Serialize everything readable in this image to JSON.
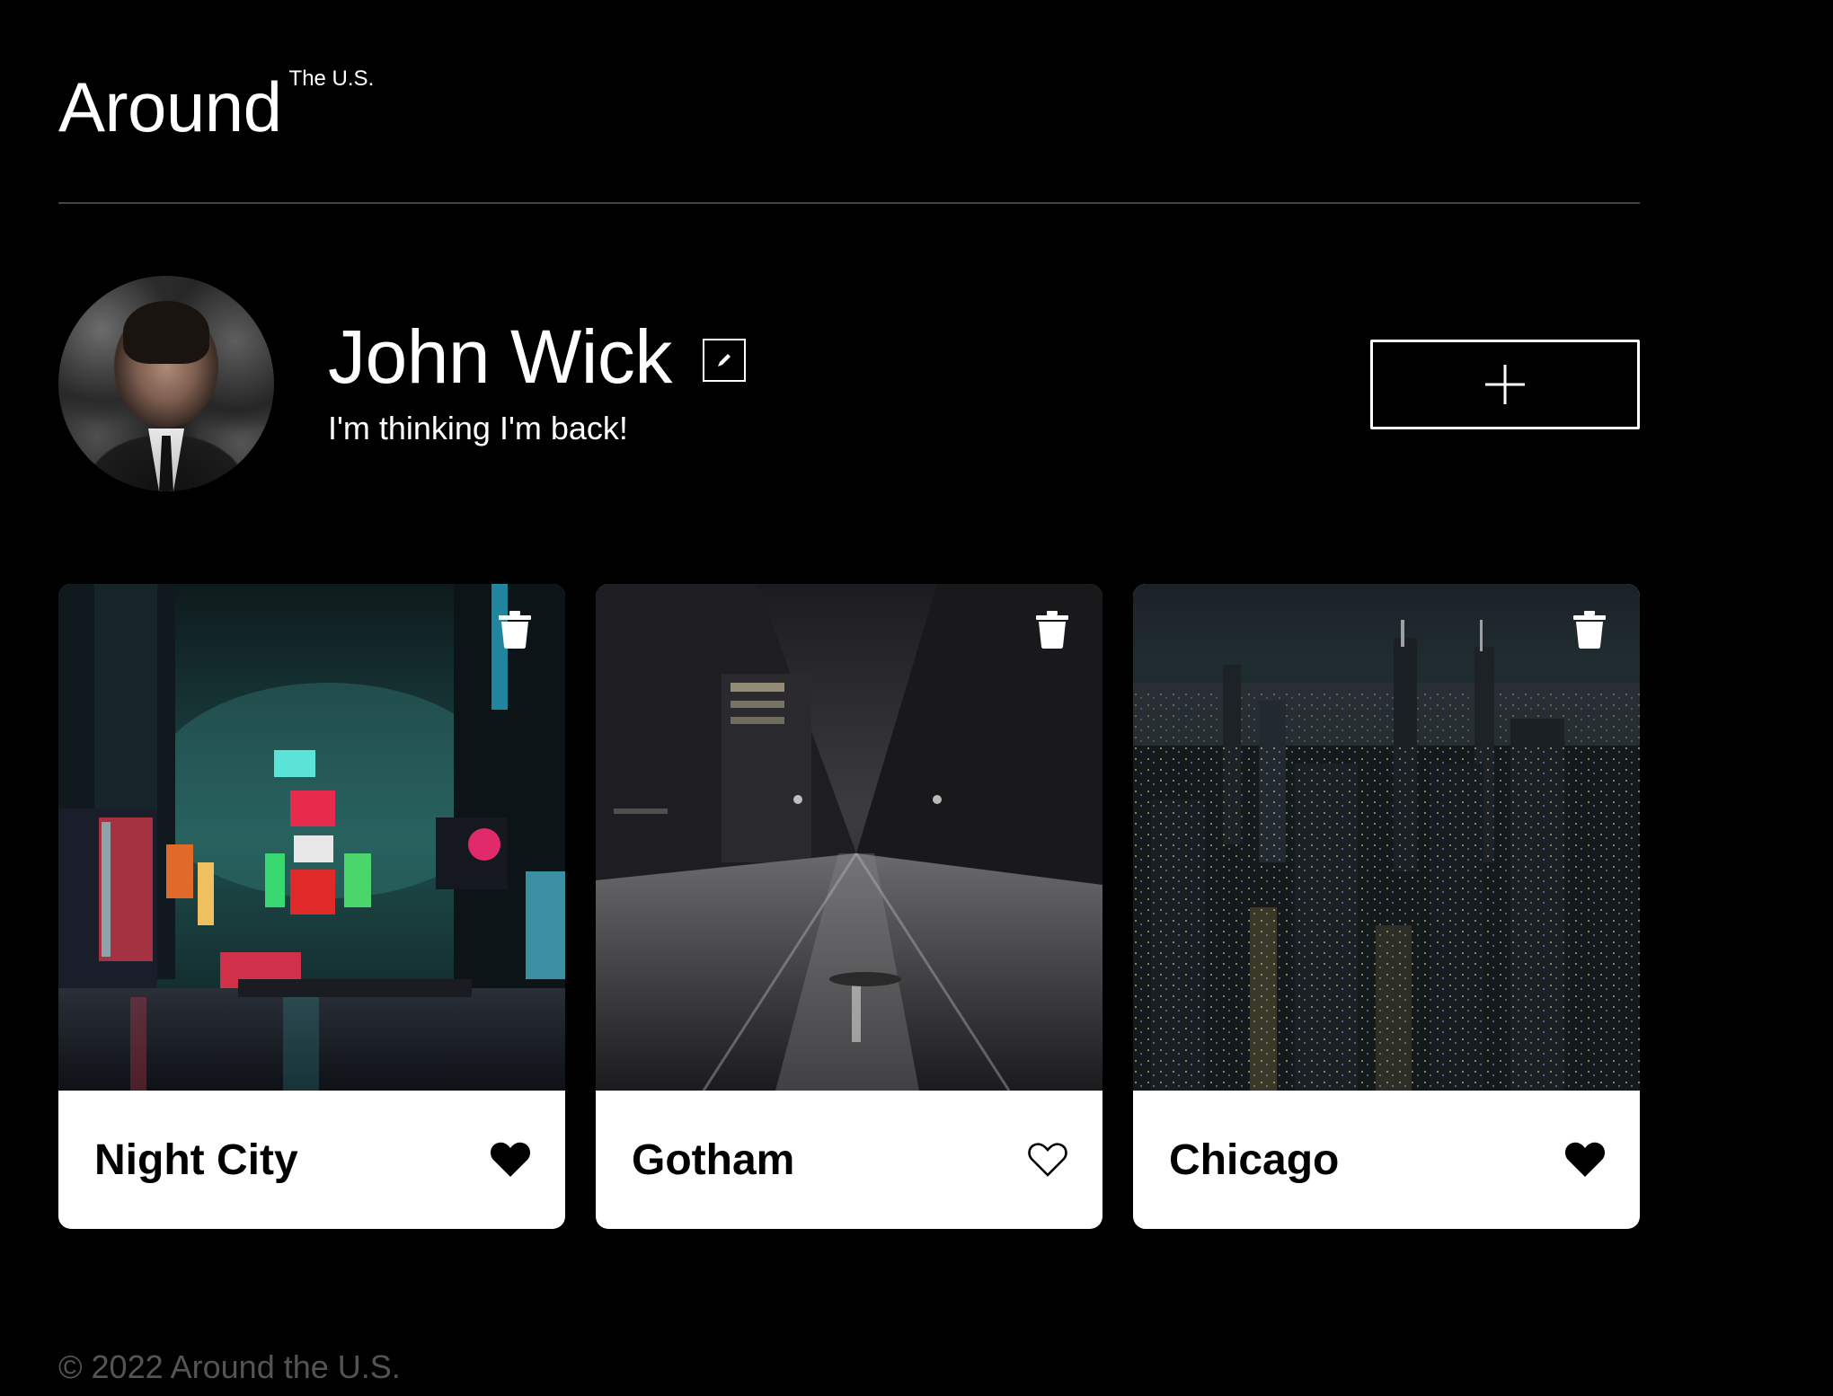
{
  "header": {
    "logo_main": "Around",
    "logo_sup": "The U.S."
  },
  "profile": {
    "name": "John Wick",
    "about": "I'm thinking I'm back!",
    "avatar_alt": "avatar",
    "edit_icon": "pencil-icon",
    "add_icon": "plus-icon"
  },
  "cards": [
    {
      "title": "Night City",
      "liked": true
    },
    {
      "title": "Gotham",
      "liked": false
    },
    {
      "title": "Chicago",
      "liked": true
    }
  ],
  "footer": {
    "copyright": "© 2022 Around the U.S."
  },
  "colors": {
    "background": "#000000",
    "text": "#ffffff",
    "card": "#ffffff",
    "footer_text": "#545454"
  }
}
